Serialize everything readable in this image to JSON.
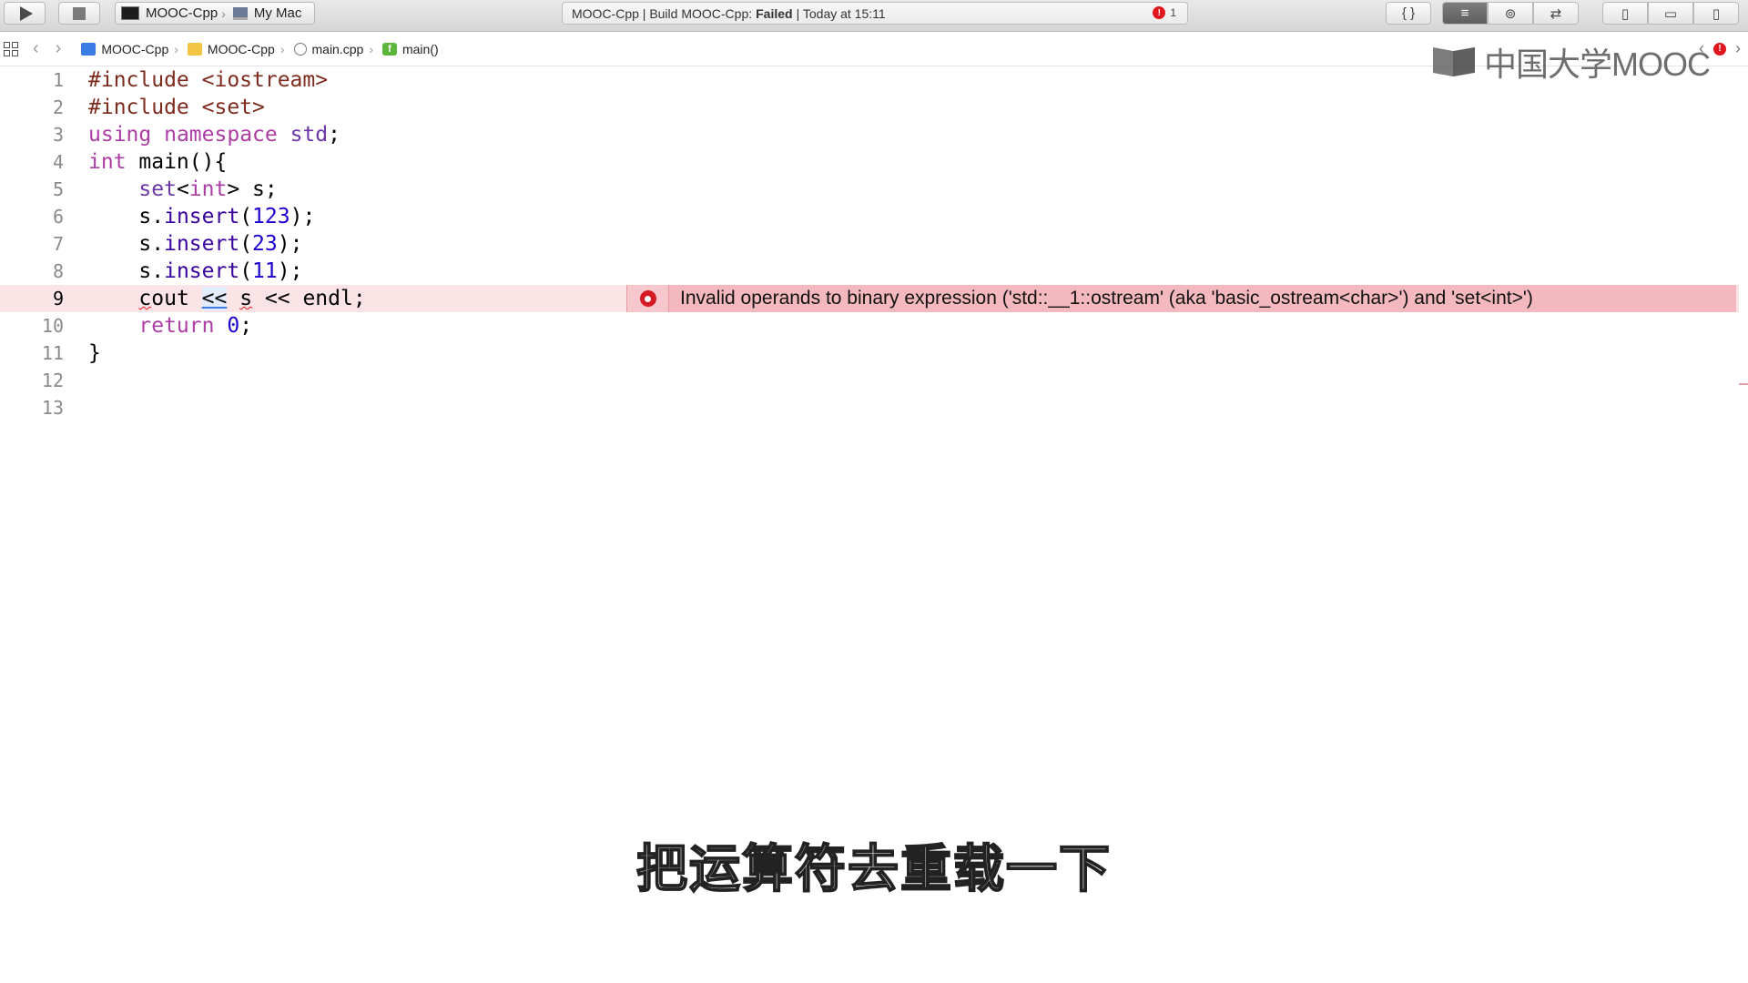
{
  "toolbar": {
    "scheme": "MOOC-Cpp",
    "destination": "My Mac",
    "status_prefix": "MOOC-Cpp | Build MOOC-Cpp:",
    "status_result": "Failed",
    "status_time": "| Today at 15:11",
    "error_count": "1",
    "error_badge_symbol": "!",
    "editor_braces": "{ }"
  },
  "jumpbar": {
    "breadcrumbs": [
      "MOOC-Cpp",
      "MOOC-Cpp",
      "main.cpp",
      "main()"
    ],
    "func_icon_symbol": "f",
    "error_symbol": "!"
  },
  "watermark": {
    "text": "中国大学MOOC"
  },
  "editor": {
    "line_numbers": [
      "1",
      "2",
      "3",
      "4",
      "5",
      "6",
      "7",
      "8",
      "9",
      "10",
      "11",
      "12",
      "13"
    ],
    "error_line": "9",
    "error_message": "Invalid operands to binary expression ('std::__1::ostream' (aka 'basic_ostream<char>') and 'set<int>')",
    "code": {
      "l1a": "#include ",
      "l1b": "<iostream>",
      "l2a": "#include ",
      "l2b": "<set>",
      "l3a": "using",
      "l3b": "namespace",
      "l3c": "std",
      "l3d": ";",
      "l4a": "int",
      "l4b": " main(){",
      "l5a": "set",
      "l5b": "<",
      "l5c": "int",
      "l5d": "> s;",
      "l6a": "s.",
      "l6b": "insert",
      "l6c": "(",
      "l6d": "123",
      "l6e": ");",
      "l7a": "s.",
      "l7b": "insert",
      "l7c": "(",
      "l7d": "23",
      "l7e": ");",
      "l8a": "s.",
      "l8b": "insert",
      "l8c": "(",
      "l8d": "11",
      "l8e": ");",
      "l9a": "c",
      "l9b": "out ",
      "l9c": "<<",
      "l9d": " ",
      "l9e": "s",
      "l9f": " << endl;",
      "l10a": "return",
      "l10b": "0",
      "l10c": ";",
      "l11a": "}"
    }
  },
  "subtitle": "把运算符去重载一下"
}
